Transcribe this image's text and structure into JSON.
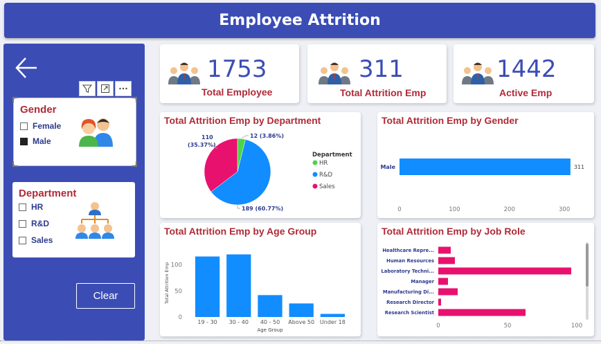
{
  "header": {
    "title": "Employee Attrition"
  },
  "sidebar": {
    "gender": {
      "title": "Gender",
      "options": [
        {
          "label": "Female",
          "checked": false
        },
        {
          "label": "Male",
          "checked": true
        }
      ]
    },
    "department": {
      "title": "Department",
      "options": [
        {
          "label": "HR",
          "checked": false
        },
        {
          "label": "R&D",
          "checked": false
        },
        {
          "label": "Sales",
          "checked": false
        }
      ]
    },
    "clear_label": "Clear"
  },
  "kpis": [
    {
      "value": "1753",
      "label": "Total Employee"
    },
    {
      "value": "311",
      "label": "Total Attrition Emp"
    },
    {
      "value": "1442",
      "label": "Active Emp"
    }
  ],
  "colors": {
    "header": "#3b4db5",
    "title_red": "#b02a37",
    "blue": "#118dff",
    "pink": "#e8116e",
    "green": "#4cd34c"
  },
  "chart_data": [
    {
      "type": "pie",
      "title": "Total Attrition Emp by Department",
      "legend_title": "Department",
      "legend_position": "right",
      "categories": [
        "HR",
        "R&D",
        "Sales"
      ],
      "values": [
        12,
        189,
        110
      ],
      "labels": [
        "12 (3.86%)",
        "189 (60.77%)",
        "110\n(35.37%)"
      ],
      "colors": [
        "#4cd34c",
        "#118dff",
        "#e8116e"
      ]
    },
    {
      "type": "bar",
      "orientation": "horizontal",
      "title": "Total Attrition Emp by Gender",
      "categories": [
        "Male"
      ],
      "values": [
        311
      ],
      "xlim": [
        0,
        320
      ],
      "ticks": [
        0,
        100,
        200,
        300
      ]
    },
    {
      "type": "bar",
      "title": "Total Attrition Emp by Age Group",
      "xlabel": "Age Group",
      "ylabel": "Total Attrition Emp",
      "categories": [
        "19 - 30",
        "30 - 40",
        "40 - 50",
        "Above 50",
        "Under 18"
      ],
      "values": [
        116,
        120,
        42,
        26,
        6
      ],
      "ylim": [
        0,
        130
      ],
      "ticks": [
        0,
        50,
        100
      ]
    },
    {
      "type": "bar",
      "orientation": "horizontal",
      "title": "Total Attrition Emp by Job Role",
      "categories": [
        "Healthcare Repre...",
        "Human Resources",
        "Laboratory Techni...",
        "Manager",
        "Manufacturing Di...",
        "Research Director",
        "Research Scientist"
      ],
      "values": [
        9,
        12,
        96,
        7,
        14,
        2,
        63
      ],
      "xlim": [
        0,
        100
      ],
      "ticks": [
        0,
        50,
        100
      ]
    }
  ]
}
